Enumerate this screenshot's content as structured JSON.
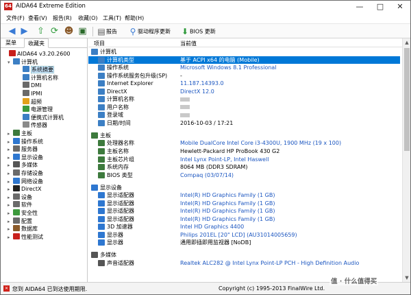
{
  "window": {
    "title": "AIDA64 Extreme Edition"
  },
  "menubar": [
    "文件(F)",
    "查看(V)",
    "报告(R)",
    "收藏(O)",
    "工具(T)",
    "帮助(H)"
  ],
  "toolbar": {
    "report_label": "报告",
    "driver_update_label": "驱动程序更新",
    "bios_update_label": "BIOS 更新"
  },
  "left_tabs": [
    "菜单",
    "收藏夹"
  ],
  "tree": [
    {
      "label": "AIDA64 v3.20.2600",
      "icon_color": "#c8201c"
    },
    {
      "label": "计算机",
      "icon_color": "#3c7fc4"
    },
    {
      "label": "系统摘要",
      "icon_color": "#3c7fc4",
      "selected": true
    },
    {
      "label": "计算机名称",
      "icon_color": "#3c7fc4"
    },
    {
      "label": "DMI",
      "icon_color": "#6a6a6a"
    },
    {
      "label": "IPMI",
      "icon_color": "#6a6a6a"
    },
    {
      "label": "超频",
      "icon_color": "#e3a11b"
    },
    {
      "label": "电源管理",
      "icon_color": "#3d9a3d"
    },
    {
      "label": "便携式计算机",
      "icon_color": "#3c7fc4"
    },
    {
      "label": "传感器",
      "icon_color": "#8a8a8a"
    },
    {
      "label": "主板",
      "icon_color": "#3d7a3d"
    },
    {
      "label": "操作系统",
      "icon_color": "#2e77d0"
    },
    {
      "label": "服务器",
      "icon_color": "#6a6a6a"
    },
    {
      "label": "显示设备",
      "icon_color": "#2e77d0"
    },
    {
      "label": "多媒体",
      "icon_color": "#555555"
    },
    {
      "label": "存储设备",
      "icon_color": "#6a6a6a"
    },
    {
      "label": "网络设备",
      "icon_color": "#2e77d0"
    },
    {
      "label": "DirectX",
      "icon_color": "#222222"
    },
    {
      "label": "设备",
      "icon_color": "#6a6a6a"
    },
    {
      "label": "软件",
      "icon_color": "#6a6a6a"
    },
    {
      "label": "安全性",
      "icon_color": "#3d9a3d"
    },
    {
      "label": "配置",
      "icon_color": "#6a6a6a"
    },
    {
      "label": "数据库",
      "icon_color": "#8a5a2a"
    },
    {
      "label": "性能测试",
      "icon_color": "#c8201c"
    }
  ],
  "columns": {
    "item": "项目",
    "value": "当前值"
  },
  "sections": [
    {
      "title": "计算机",
      "rows": [
        {
          "name": "计算机类型",
          "value": "基于 ACPI x64 的电脑  (Mobile)",
          "link": false,
          "highlight": true
        },
        {
          "name": "操作系统",
          "value": "Microsoft Windows 8.1 Professional",
          "link": true
        },
        {
          "name": "操作系统服务包升级(SP)",
          "value": "-",
          "link": false
        },
        {
          "name": "Internet Explorer",
          "value": "11.187.14393.0",
          "link": true
        },
        {
          "name": "DirectX",
          "value": "DirectX 12.0",
          "link": true
        },
        {
          "name": "计算机名称",
          "value": "",
          "redacted": true
        },
        {
          "name": "用户名称",
          "value": "",
          "redacted": true
        },
        {
          "name": "登录域",
          "value": "",
          "redacted": true
        },
        {
          "name": "日期/时间",
          "value": "2016-10-03 / 17:21",
          "link": false
        }
      ]
    },
    {
      "title": "主板",
      "rows": [
        {
          "name": "处理器名称",
          "value": "Mobile DualCore Intel Core i3-4300U, 1900 MHz (19 x 100)",
          "link": true
        },
        {
          "name": "主板名称",
          "value": "Hewlett-Packard HP ProBook 430 G2",
          "link": false
        },
        {
          "name": "主板芯片组",
          "value": "Intel Lynx Point-LP, Intel Haswell",
          "link": true
        },
        {
          "name": "系统内存",
          "value": "8064 MB  (DDR3 SDRAM)",
          "link": false
        },
        {
          "name": "BIOS 类型",
          "value": "Compaq (03/07/14)",
          "link": true
        }
      ]
    },
    {
      "title": "显示设备",
      "rows": [
        {
          "name": "显示适配器",
          "value": "Intel(R) HD Graphics Family  (1 GB)",
          "link": true
        },
        {
          "name": "显示适配器",
          "value": "Intel(R) HD Graphics Family  (1 GB)",
          "link": true
        },
        {
          "name": "显示适配器",
          "value": "Intel(R) HD Graphics Family  (1 GB)",
          "link": true
        },
        {
          "name": "显示适配器",
          "value": "Intel(R) HD Graphics Family  (1 GB)",
          "link": true
        },
        {
          "name": "3D 加速器",
          "value": "Intel HD Graphics 4400",
          "link": true
        },
        {
          "name": "显示器",
          "value": "Philips 201EL  [20\" LCD]  (AU31014005659)",
          "link": true
        },
        {
          "name": "显示器",
          "value": "通用即插即用监视器 [NoDB]",
          "link": false
        }
      ]
    },
    {
      "title": "多媒体",
      "rows": [
        {
          "name": "声音适配器",
          "value": "Realtek ALC282 @ Intel Lynx Point-LP PCH - High Definition Audio",
          "link": true
        }
      ]
    }
  ],
  "status": {
    "warning": "您到 AIDA64 已到达使用期限.",
    "copyright": "Copyright (c) 1995-2013 FinalWire Ltd."
  },
  "watermark": "值 · 什么值得买"
}
